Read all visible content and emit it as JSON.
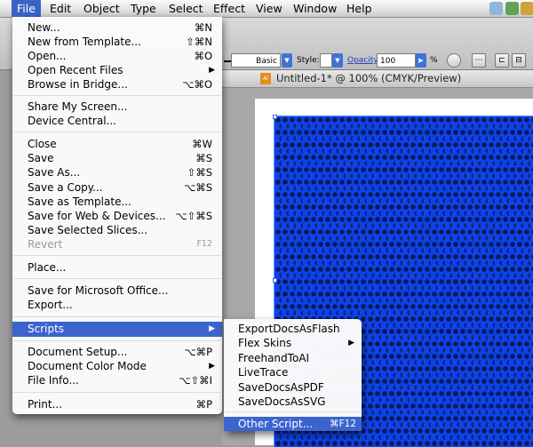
{
  "menubar": {
    "items": [
      "File",
      "Edit",
      "Object",
      "Type",
      "Select",
      "Effect",
      "View",
      "Window",
      "Help"
    ],
    "active": "File"
  },
  "controlbar": {
    "stroke_style": "Basic",
    "style_label": "Style:",
    "opacity_label": "Opacity",
    "opacity_value": "100",
    "percent": "%"
  },
  "document": {
    "title": "Untitled-1* @ 100% (CMYK/Preview)"
  },
  "file_menu": {
    "new": {
      "label": "New...",
      "shortcut": "⌘N"
    },
    "new_template": {
      "label": "New from Template...",
      "shortcut": "⇧⌘N"
    },
    "open": {
      "label": "Open...",
      "shortcut": "⌘O"
    },
    "open_recent": {
      "label": "Open Recent Files"
    },
    "browse_bridge": {
      "label": "Browse in Bridge...",
      "shortcut": "⌥⌘O"
    },
    "share_screen": {
      "label": "Share My Screen..."
    },
    "device_central": {
      "label": "Device Central..."
    },
    "close": {
      "label": "Close",
      "shortcut": "⌘W"
    },
    "save": {
      "label": "Save",
      "shortcut": "⌘S"
    },
    "save_as": {
      "label": "Save As...",
      "shortcut": "⇧⌘S"
    },
    "save_copy": {
      "label": "Save a Copy...",
      "shortcut": "⌥⌘S"
    },
    "save_template": {
      "label": "Save as Template..."
    },
    "save_web": {
      "label": "Save for Web & Devices...",
      "shortcut": "⌥⇧⌘S"
    },
    "save_slices": {
      "label": "Save Selected Slices..."
    },
    "revert": {
      "label": "Revert",
      "shortcut": "F12"
    },
    "place": {
      "label": "Place..."
    },
    "save_office": {
      "label": "Save for Microsoft Office..."
    },
    "export": {
      "label": "Export..."
    },
    "scripts": {
      "label": "Scripts"
    },
    "document_setup": {
      "label": "Document Setup...",
      "shortcut": "⌥⌘P"
    },
    "document_color_mode": {
      "label": "Document Color Mode"
    },
    "file_info": {
      "label": "File Info...",
      "shortcut": "⌥⇧⌘I"
    },
    "print": {
      "label": "Print...",
      "shortcut": "⌘P"
    }
  },
  "scripts_menu": {
    "items": [
      "ExportDocsAsFlash",
      "Flex Skins",
      "FreehandToAI",
      "LiveTrace",
      "SaveDocsAsPDF",
      "SaveDocsAsSVG"
    ],
    "other": {
      "label": "Other Script...",
      "shortcut": "⌘F12"
    }
  },
  "colors": {
    "menu_highlight": "#3c64cf",
    "artwork_blue": "#0d43ee",
    "doc_icon": "#e48c1e"
  }
}
